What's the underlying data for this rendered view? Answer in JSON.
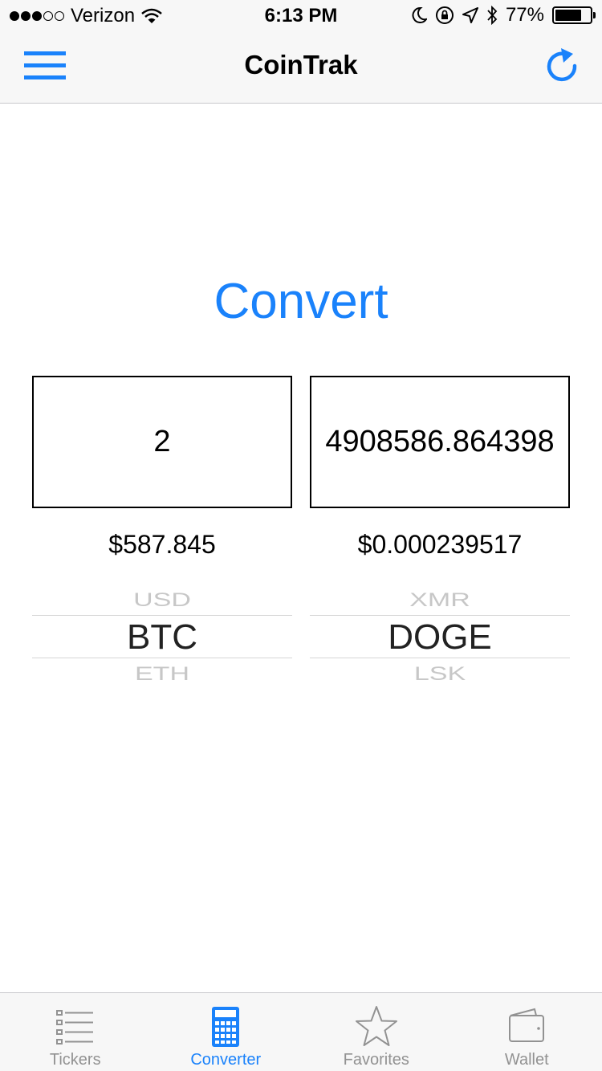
{
  "status_bar": {
    "carrier": "Verizon",
    "time": "6:13 PM",
    "battery": "77%",
    "battery_level": 0.77
  },
  "nav": {
    "title": "CoinTrak",
    "menu_icon": "hamburger-menu-icon",
    "refresh_icon": "refresh-icon"
  },
  "converter": {
    "title": "Convert",
    "from_amount": "2",
    "to_amount": "4908586.864398",
    "from_price": "$587.845",
    "to_price": "$0.000239517",
    "from_picker": {
      "above": "USD",
      "selected": "BTC",
      "below": "ETH"
    },
    "to_picker": {
      "above": "XMR",
      "selected": "DOGE",
      "below": "LSK"
    }
  },
  "tabs": [
    {
      "label": "Tickers",
      "icon": "list-icon",
      "active": false
    },
    {
      "label": "Converter",
      "icon": "calculator-icon",
      "active": true
    },
    {
      "label": "Favorites",
      "icon": "star-icon",
      "active": false
    },
    {
      "label": "Wallet",
      "icon": "wallet-icon",
      "active": false
    }
  ],
  "colors": {
    "accent": "#1a82fb",
    "inactive_tab": "#929292",
    "bar_background": "#f7f7f7"
  }
}
